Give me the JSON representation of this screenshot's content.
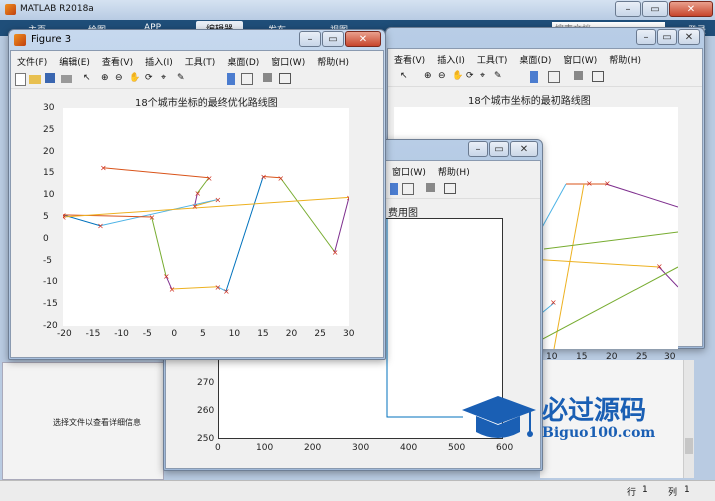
{
  "matlab": {
    "title": "MATLAB R2018a",
    "tabs": [
      "主页",
      "绘图",
      "APP",
      "编辑器",
      "发布",
      "视图"
    ],
    "search_placeholder": "搜索文档",
    "login_label": "登录",
    "details_text": "选择文件以查看详细信息",
    "status_row_label": "行",
    "status_row_value": "1",
    "status_col_label": "列",
    "status_col_value": "1"
  },
  "figure3": {
    "title": "Figure 3",
    "menu": [
      "文件(F)",
      "编辑(E)",
      "查看(V)",
      "插入(I)",
      "工具(T)",
      "桌面(D)",
      "窗口(W)",
      "帮助(H)"
    ],
    "chart_title": "18个城市坐标的最终优化路线图"
  },
  "figure_back": {
    "menu": [
      "查看(V)",
      "插入(I)",
      "工具(T)",
      "桌面(D)",
      "窗口(W)",
      "帮助(H)"
    ],
    "chart_title": "18个城市坐标的最初路线图"
  },
  "figure_mid": {
    "menu": [
      "窗口(W)",
      "帮助(H)"
    ],
    "chart_title_fragment": "费用图"
  },
  "watermark": {
    "brand": "必过源码",
    "url": "Biguo100.com"
  },
  "chart_data": [
    {
      "type": "line",
      "title": "18个城市坐标的最终优化路线图",
      "xlim": [
        -20,
        30
      ],
      "ylim": [
        -20,
        30
      ],
      "xticks": [
        -20,
        -15,
        -10,
        -5,
        0,
        5,
        10,
        15,
        20,
        25,
        30
      ],
      "yticks": [
        -20,
        -15,
        -10,
        -5,
        0,
        5,
        10,
        15,
        20,
        25,
        30
      ],
      "cities": [
        [
          -13,
          16.3
        ],
        [
          5.5,
          14
        ],
        [
          3.5,
          10.5
        ],
        [
          3,
          7.5
        ],
        [
          7,
          9
        ],
        [
          -13.5,
          3
        ],
        [
          -20,
          5.5
        ],
        [
          -4.5,
          5
        ],
        [
          -2,
          -8.5
        ],
        [
          -1,
          -11.5
        ],
        [
          7,
          -11
        ],
        [
          8.5,
          -12
        ],
        [
          15,
          14.3
        ],
        [
          18,
          14
        ],
        [
          27.5,
          -3
        ],
        [
          30,
          9.5
        ],
        [
          -20,
          5
        ]
      ]
    },
    {
      "type": "line",
      "title": "18个城市坐标的最初路线图",
      "xlim": [
        -20,
        30
      ],
      "ylim": [
        -20,
        30
      ],
      "xticks": [
        10,
        15,
        20,
        25,
        30
      ]
    },
    {
      "type": "line",
      "title": "费用图",
      "xlim": [
        0,
        600
      ],
      "ylim": [
        250,
        290
      ],
      "xticks": [
        0,
        100,
        200,
        300,
        400,
        500,
        600
      ],
      "yticks": [
        250,
        260,
        270
      ]
    }
  ]
}
